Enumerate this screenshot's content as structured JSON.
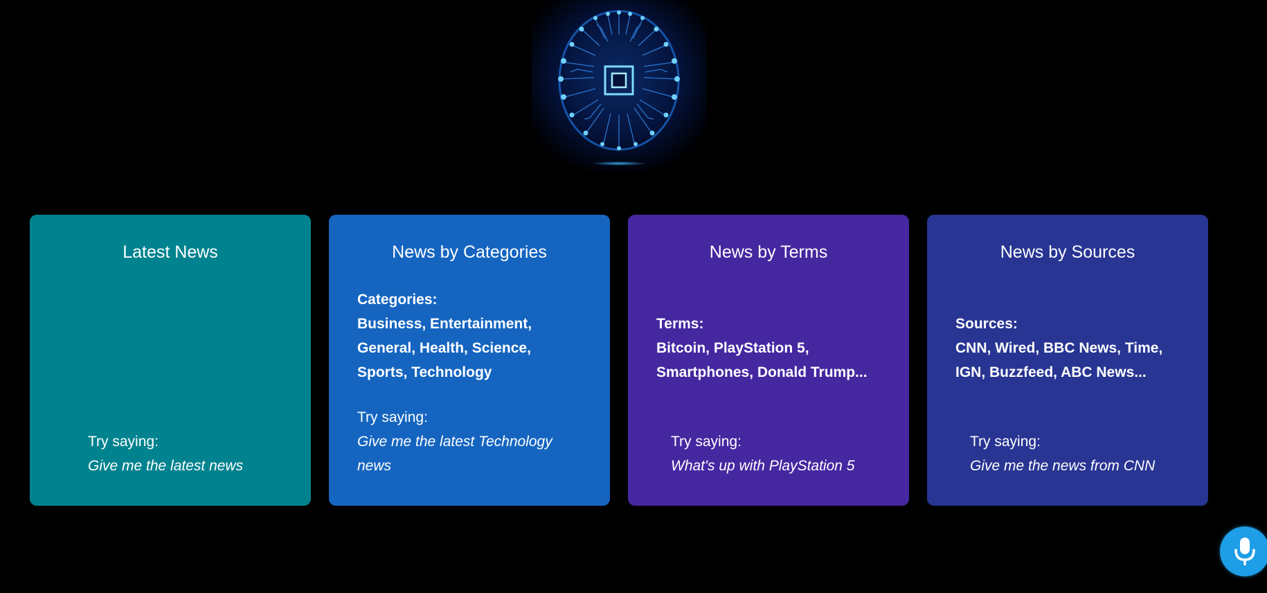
{
  "logo": {
    "icon": "circuit-brain-icon"
  },
  "cards": [
    {
      "title": "Latest News",
      "info_heading": "",
      "info_lines": [],
      "try_label": "Try saying:",
      "try_example": "Give me the latest news",
      "color": "#00838f"
    },
    {
      "title": "News by Categories",
      "info_heading": "Categories:",
      "info_lines": [
        "Business, Entertainment,",
        "General, Health, Science,",
        "Sports, Technology"
      ],
      "try_label": "Try saying:",
      "try_example_line1": "Give me the latest Technology",
      "try_example_line2": "news",
      "color": "#1565c0"
    },
    {
      "title": "News by Terms",
      "info_heading": "Terms:",
      "info_lines": [
        "Bitcoin, PlayStation 5,",
        "Smartphones, Donald Trump..."
      ],
      "try_label": "Try saying:",
      "try_example": "What's up with PlayStation 5",
      "color": "#4527a0"
    },
    {
      "title": "News by Sources",
      "info_heading": "Sources:",
      "info_lines": [
        "CNN, Wired, BBC News, Time,",
        "IGN, Buzzfeed, ABC News..."
      ],
      "try_label": "Try saying:",
      "try_example": "Give me the news from CNN",
      "color": "#283593"
    }
  ],
  "mic": {
    "icon": "microphone-icon",
    "color": "#1e9ee6"
  }
}
